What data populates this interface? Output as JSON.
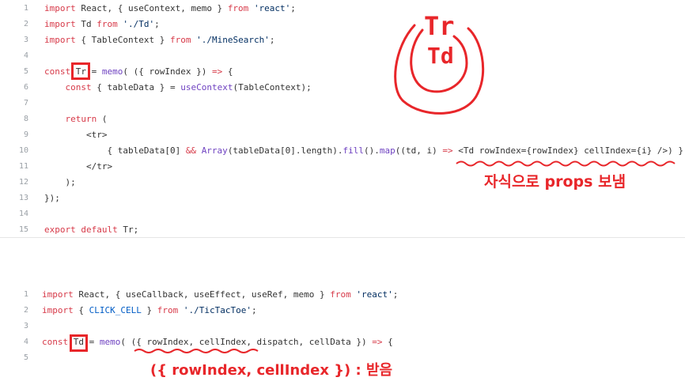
{
  "snippet1": {
    "lines": [
      {
        "n": "1",
        "t": "import React, { useContext, memo } from 'react';"
      },
      {
        "n": "2",
        "t": "import Td from './Td';"
      },
      {
        "n": "3",
        "t": "import { TableContext } from './MineSearch';"
      },
      {
        "n": "4",
        "t": ""
      },
      {
        "n": "5",
        "t": "const Tr = memo( ({ rowIndex }) => {"
      },
      {
        "n": "6",
        "t": "    const { tableData } = useContext(TableContext);"
      },
      {
        "n": "7",
        "t": ""
      },
      {
        "n": "8",
        "t": "    return ("
      },
      {
        "n": "9",
        "t": "        <tr>"
      },
      {
        "n": "10",
        "t": "            { tableData[0] && Array(tableData[0].length).fill().map((td, i) => <Td rowIndex={rowIndex} cellIndex={i} />) }"
      },
      {
        "n": "11",
        "t": "        </tr>"
      },
      {
        "n": "12",
        "t": "    );"
      },
      {
        "n": "13",
        "t": "});"
      },
      {
        "n": "14",
        "t": ""
      },
      {
        "n": "15",
        "t": "export default Tr;"
      }
    ]
  },
  "snippet2": {
    "lines": [
      {
        "n": "1",
        "t": "import React, { useCallback, useEffect, useRef, memo } from 'react';"
      },
      {
        "n": "2",
        "t": "import { CLICK_CELL } from './TicTacToe';"
      },
      {
        "n": "3",
        "t": ""
      },
      {
        "n": "4",
        "t": "const Td = memo( ({ rowIndex, cellIndex, dispatch, cellData }) => {"
      },
      {
        "n": "5",
        "t": ""
      }
    ]
  },
  "annotations": {
    "sketch_top": "Tr",
    "sketch_bottom": "Td",
    "props_note": "자식으로 props 보냄",
    "receive_note": "({ rowIndex, cellIndex }) : 받음"
  },
  "colors": {
    "annotation": "#e8262a",
    "keyword": "#d73a49",
    "string": "#032f62"
  }
}
